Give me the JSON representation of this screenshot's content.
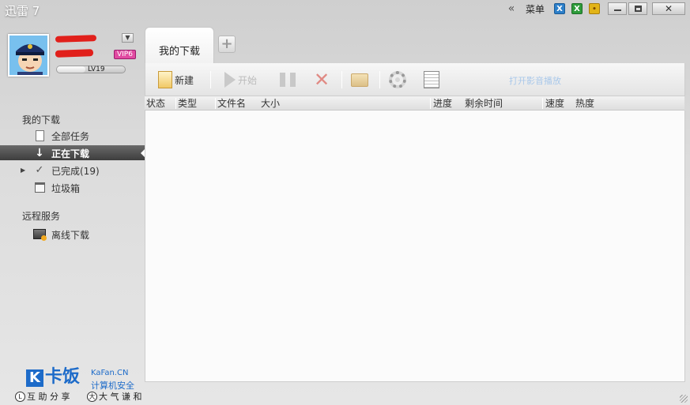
{
  "app": {
    "title": "迅雷 7"
  },
  "titlebar": {
    "menu_label": "菜单",
    "skins": [
      {
        "name": "skin-blue",
        "color": "#2c7fc9"
      },
      {
        "name": "skin-green",
        "color": "#2d9b3a"
      },
      {
        "name": "skin-yellow",
        "color": "#e2b417"
      }
    ]
  },
  "user": {
    "vip_label": "VIP6",
    "level_label": "LV19",
    "level_progress": 0.42
  },
  "sidebar": {
    "section1": "我的下载",
    "items": [
      {
        "label": "全部任务",
        "icon": "document-icon"
      },
      {
        "label": "正在下载",
        "icon": "arrow-down-icon",
        "active": true
      },
      {
        "label": "已完成(19)",
        "icon": "check-icon"
      },
      {
        "label": "垃圾箱",
        "icon": "trash-icon"
      }
    ],
    "section2": "远程服务",
    "remote_items": [
      {
        "label": "离线下载",
        "icon": "offline-download-icon"
      }
    ]
  },
  "tabs": {
    "active": "我的下载",
    "add_icon": "plus-icon"
  },
  "toolbar": {
    "new_label": "新建",
    "start_label": "开始",
    "link_text": "打开影音播放"
  },
  "table": {
    "columns": [
      "状态",
      "类型",
      "文件名",
      "大小",
      "进度",
      "剩余时间",
      "速度",
      "热度"
    ]
  },
  "brand": {
    "logo_text": "卡饭",
    "name": "KaFan.CN",
    "sub": "计算机安全"
  },
  "footer": {
    "left": "互 助 分 享",
    "right": "大 气 谦 和",
    "left_circle": "L",
    "right_circle": "大"
  }
}
